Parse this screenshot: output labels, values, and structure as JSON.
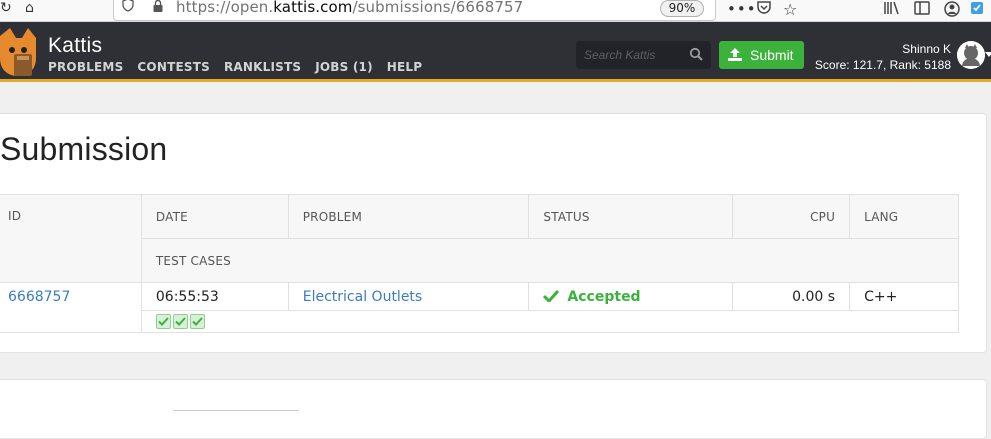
{
  "browser": {
    "url_prefix": "https://open.",
    "url_domain": "kattis.com",
    "url_path": "/submissions/6668757",
    "zoom": "90%"
  },
  "header": {
    "brand": "Kattis",
    "menu": [
      "PROBLEMS",
      "CONTESTS",
      "RANKLISTS",
      "JOBS (1)",
      "HELP"
    ],
    "search_placeholder": "Search Kattis",
    "submit_label": "Submit",
    "user_name": "Shinno K",
    "user_score": "Score: 121.7, Rank: 5188"
  },
  "page": {
    "title": "Submission"
  },
  "table": {
    "headers": {
      "id": "ID",
      "date": "DATE",
      "problem": "PROBLEM",
      "status": "STATUS",
      "cpu": "CPU",
      "lang": "LANG",
      "test_cases": "TEST CASES"
    },
    "row": {
      "id": "6668757",
      "date": "06:55:53",
      "problem": "Electrical Outlets",
      "status": "Accepted",
      "cpu": "0.00 s",
      "lang": "C++",
      "test_cases_passed": 3
    }
  },
  "colors": {
    "header_bg": "#2f3036",
    "accent": "#e5a827",
    "accepted": "#3bb33b",
    "link": "#3a7cc2"
  }
}
